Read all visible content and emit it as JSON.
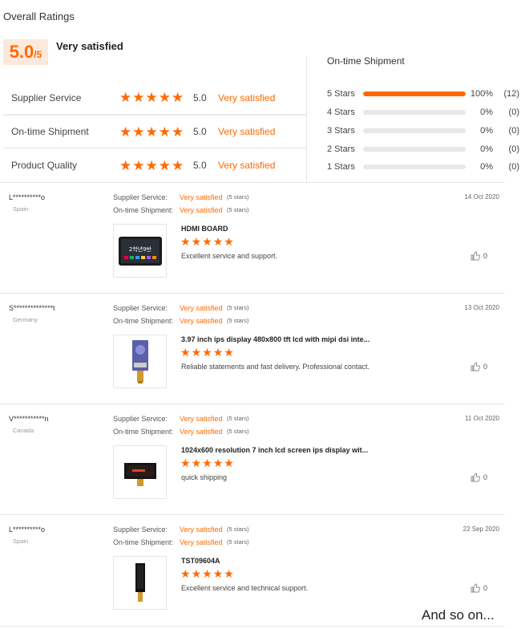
{
  "title": "Overall Ratings",
  "overall": {
    "score": "5.0",
    "out_of": "/5",
    "description": "Very satisfied"
  },
  "metrics": [
    {
      "label": "Supplier Service",
      "stars": 5,
      "value": "5.0",
      "description": "Very satisfied"
    },
    {
      "label": "On-time Shipment",
      "stars": 5,
      "value": "5.0",
      "description": "Very satisfied"
    },
    {
      "label": "Product Quality",
      "stars": 5,
      "value": "5.0",
      "description": "Very satisfied"
    }
  ],
  "distribution": {
    "title": "On-time Shipment",
    "rows": [
      {
        "label": "5 Stars",
        "percent": "100%",
        "count": "(12)",
        "fill": 1.0
      },
      {
        "label": "4 Stars",
        "percent": "0%",
        "count": "(0)",
        "fill": 0
      },
      {
        "label": "3 Stars",
        "percent": "0%",
        "count": "(0)",
        "fill": 0
      },
      {
        "label": "2 Stars",
        "percent": "0%",
        "count": "(0)",
        "fill": 0
      },
      {
        "label": "1 Stars",
        "percent": "0%",
        "count": "(0)",
        "fill": 0
      }
    ]
  },
  "reviews": [
    {
      "name": "L**********o",
      "country": "Spain",
      "date": "14 Oct 2020",
      "supplier_label": "Supplier Service:",
      "supplier_value": "Very satisfied",
      "supplier_stars": "(5 stars)",
      "shipment_label": "On-time Shipment:",
      "shipment_value": "Very satisfied",
      "shipment_stars": "(5 stars)",
      "product": "HDMI BOARD",
      "stars": 5,
      "comment": "Excellent service and support.",
      "likes": "0",
      "thumb_icon": "tablet-screen-icon"
    },
    {
      "name": "S**************t",
      "country": "Germany",
      "date": "13 Oct 2020",
      "supplier_label": "Supplier Service:",
      "supplier_value": "Very satisfied",
      "supplier_stars": "(5 stars)",
      "shipment_label": "On-time Shipment:",
      "shipment_value": "Very satisfied",
      "shipment_stars": "(5 stars)",
      "product": "3.97 inch ips display 480x800 tft lcd with mipi dsi inte...",
      "stars": 5,
      "comment": "Reliable statements and fast delivery. Professional contact.",
      "likes": "0",
      "thumb_icon": "lcd-module-icon"
    },
    {
      "name": "V***********n",
      "country": "Canada",
      "date": "11 Oct 2020",
      "supplier_label": "Supplier Service:",
      "supplier_value": "Very satisfied",
      "supplier_stars": "(5 stars)",
      "shipment_label": "On-time Shipment:",
      "shipment_value": "Very satisfied",
      "shipment_stars": "(5 stars)",
      "product": "1024x600 resolution 7 inch lcd screen ips display wit...",
      "stars": 5,
      "comment": "quick shipping",
      "likes": "0",
      "thumb_icon": "lcd-panel-icon"
    },
    {
      "name": "L**********o",
      "country": "Spain",
      "date": "22 Sep 2020",
      "supplier_label": "Supplier Service:",
      "supplier_value": "Very satisfied",
      "supplier_stars": "(5 stars)",
      "shipment_label": "On-time Shipment:",
      "shipment_value": "Very satisfied",
      "shipment_stars": "(5 stars)",
      "product": "TST09604A",
      "stars": 5,
      "comment": "Excellent service and technical support.",
      "likes": "0",
      "thumb_icon": "narrow-lcd-icon"
    }
  ],
  "footer_note": "And so on...",
  "colors": {
    "accent": "#ff6a00",
    "badge_bg": "#fde9dc",
    "bar_bg": "#e8e8e8"
  }
}
